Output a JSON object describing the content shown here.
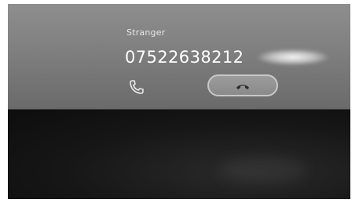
{
  "call": {
    "caller_label": "Stranger",
    "phone_number": "07522638212"
  },
  "icons": {
    "phone": "phone-icon",
    "end_call": "end-call-icon"
  },
  "colors": {
    "card_background": "#8e8e8e",
    "screen_background": "#101010",
    "text": "#ffffff"
  }
}
